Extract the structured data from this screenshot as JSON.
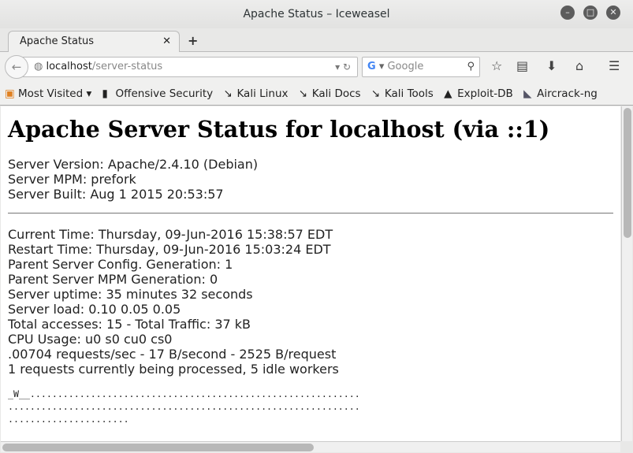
{
  "window": {
    "title": "Apache Status – Iceweasel"
  },
  "tabs": [
    {
      "label": "Apache Status"
    }
  ],
  "navbar": {
    "url_host": "localhost",
    "url_path": "/server-status",
    "search_placeholder": "Google"
  },
  "bookmarks": [
    {
      "label": "Most Visited ▾",
      "icon": "folder-icon"
    },
    {
      "label": "Offensive Security",
      "icon": "offsec-icon"
    },
    {
      "label": "Kali Linux",
      "icon": "kali-dragon-icon"
    },
    {
      "label": "Kali Docs",
      "icon": "kali-dragon-icon"
    },
    {
      "label": "Kali Tools",
      "icon": "kali-dragon-icon"
    },
    {
      "label": "Exploit-DB",
      "icon": "exploitdb-icon"
    },
    {
      "label": "Aircrack-ng",
      "icon": "aircrack-icon"
    }
  ],
  "page": {
    "heading": "Apache Server Status for localhost (via ::1)",
    "server_info": [
      "Server Version: Apache/2.4.10 (Debian)",
      "Server MPM: prefork",
      "Server Built: Aug 1 2015 20:53:57"
    ],
    "status": [
      "Current Time: Thursday, 09-Jun-2016 15:38:57 EDT",
      "Restart Time: Thursday, 09-Jun-2016 15:03:24 EDT",
      "Parent Server Config. Generation: 1",
      "Parent Server MPM Generation: 0",
      "Server uptime: 35 minutes 32 seconds",
      "Server load: 0.10 0.05 0.05",
      "Total accesses: 15 - Total Traffic: 37 kB",
      "CPU Usage: u0 s0 cu0 cs0",
      ".00704 requests/sec - 17 B/second - 2525 B/request",
      "1 requests currently being processed, 5 idle workers"
    ],
    "scoreboard": [
      "_W__............................................................",
      "................................................................",
      "......................"
    ]
  }
}
